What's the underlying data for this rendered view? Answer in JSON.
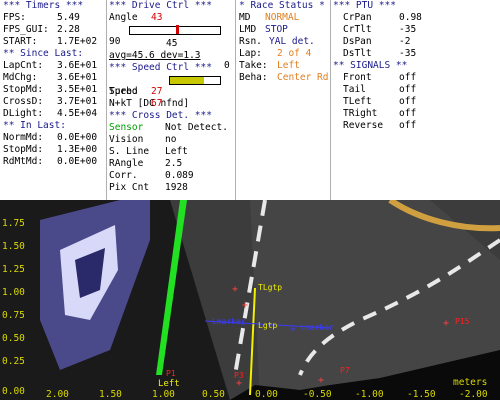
{
  "timers": {
    "title": "*** Timers ***",
    "fps_label": "FPS:",
    "fps_value": "5.49",
    "fpsgui_label": "FPS_GUI:",
    "fpsgui_value": "2.28",
    "start_label": "START:",
    "start_value": "1.7E+02",
    "since_title": "** Since Last:",
    "since": [
      {
        "label": "LapCnt:",
        "value": "3.6E+01"
      },
      {
        "label": "MdChg:",
        "value": "3.6E+01"
      },
      {
        "label": "StopMd:",
        "value": "3.5E+01"
      },
      {
        "label": "CrossD:",
        "value": "3.7E+01"
      },
      {
        "label": "DLight:",
        "value": "4.5E+04"
      }
    ],
    "inlast_title": "** In Last:",
    "inlast": [
      {
        "label": "NormMd:",
        "value": "0.0E+00"
      },
      {
        "label": "StopMd:",
        "value": "1.3E+00"
      },
      {
        "label": "RdMtMd:",
        "value": "0.0E+00"
      }
    ]
  },
  "drive": {
    "title": "*** Drive Ctrl ***",
    "angle_label": "Angle",
    "angle_value": "43",
    "slider_min": "90",
    "slider_max": "0",
    "slider_center": "45",
    "slider_value": 43,
    "avg_text": "avg=45.6 dev=1.3",
    "speed_title": "*** Speed Ctrl ***",
    "speed_label": "Speed",
    "speed_value": "67",
    "speed_fraction": 0.67,
    "turbo_label": "Turbo",
    "turbo_value": "27",
    "nkt_text": "N+kT [DC nfnd]",
    "cross_title": "*** Cross Det. ***",
    "cross": [
      {
        "label": "Sensor",
        "value": "Not Detect."
      },
      {
        "label": "Vision",
        "value": "no"
      },
      {
        "label": "S. Line",
        "value": "Left"
      },
      {
        "label": "RAngle",
        "value": "2.5"
      },
      {
        "label": "Corr.",
        "value": "0.089"
      },
      {
        "label": "Pix Cnt",
        "value": "1928"
      }
    ]
  },
  "race": {
    "title": "* Race Status *",
    "rows": [
      {
        "label": "MD",
        "value": "NORMAL",
        "color": "#e08020"
      },
      {
        "label": "LMD",
        "value": "STOP",
        "color": "#1a1a8a"
      },
      {
        "label": "Rsn.",
        "value": "YAL det.",
        "color": "#1a1a8a"
      },
      {
        "label": "Lap:",
        "value": "2 of 4",
        "color": "#e08020"
      },
      {
        "label": "Take:",
        "value": "Left",
        "color": "#e08020"
      },
      {
        "label": "Beha:",
        "value": "Center Rd",
        "color": "#e08020"
      }
    ]
  },
  "ptu": {
    "title": "*** PTU ***",
    "rows": [
      {
        "label": "CrPan",
        "value": "0.98"
      },
      {
        "label": "CrTlt",
        "value": "-35"
      },
      {
        "label": "DsPan",
        "value": "-2"
      },
      {
        "label": "DsTlt",
        "value": "-35"
      }
    ],
    "signals_title": "** SIGNALS **",
    "signals": [
      {
        "label": "Front",
        "value": "off"
      },
      {
        "label": "Tail",
        "value": "off"
      },
      {
        "label": "TLeft",
        "value": "off"
      },
      {
        "label": "TRight",
        "value": "off"
      },
      {
        "label": "Reverse",
        "value": "off"
      }
    ]
  },
  "view": {
    "y_axis": [
      "1.75",
      "1.50",
      "1.25",
      "1.00",
      "0.75",
      "0.50",
      "0.25",
      "0.00"
    ],
    "x_axis": [
      "2.00",
      "1.50",
      "1.00",
      "0.50",
      "0.00",
      "-0.50",
      "-1.00",
      "-1.50",
      "-2.00"
    ],
    "units": "meters",
    "labels": {
      "tlgtp": "TLgtp",
      "lgtp": "Lgtp",
      "lmarker": "Lmarker",
      "lmarker2": "Lmarker",
      "left": "Left",
      "p15": "P15",
      "p7": "P7",
      "p3": "P3",
      "p1": "P1"
    }
  },
  "colors": {
    "header": "#1a1a8a",
    "value_red": "#d40000",
    "value_orange": "#e08020",
    "sensor_green": "#00a000",
    "axis_yellow": "#d8d800",
    "marker_blue": "#3a3aff",
    "marker_red": "#ff2020"
  }
}
